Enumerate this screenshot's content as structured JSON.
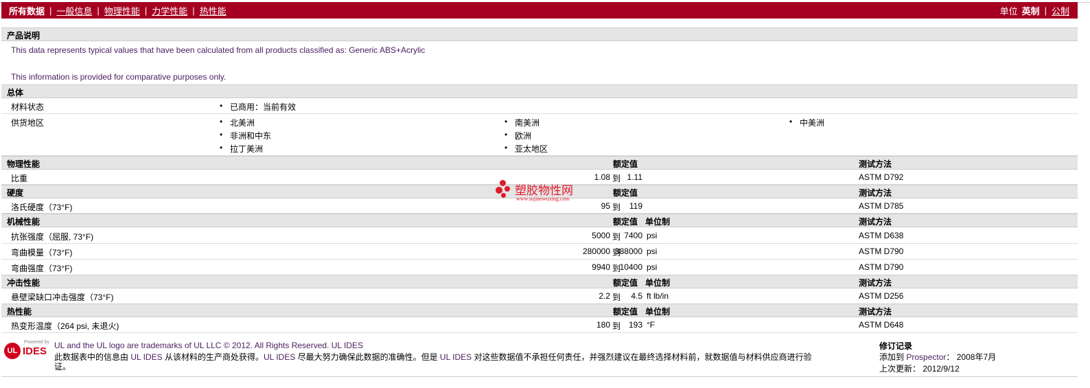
{
  "nav": {
    "all_data": "所有数据",
    "general": "一般信息",
    "physical": "物理性能",
    "mechanical": "力学性能",
    "thermal": "热性能",
    "unit_label": "单位",
    "imperial": "英制",
    "metric": "公制"
  },
  "product": {
    "header": "产品说明",
    "line1": "This data represents typical values that have been calculated from all products classified as: Generic ABS+Acrylic",
    "line2": "This information is provided for comparative purposes only."
  },
  "general": {
    "header": "总体",
    "status_label": "材料状态",
    "status_value": "已商用：当前有效",
    "region_label": "供货地区",
    "regions": [
      "北美洲",
      "非洲和中东",
      "拉丁美洲",
      "南美洲",
      "欧洲",
      "亚太地区",
      "中美洲"
    ]
  },
  "physical": {
    "header": "物理性能",
    "nominal": "额定值",
    "method": "测试方法",
    "rows": [
      {
        "name": "比重",
        "low": "1.08",
        "to": "到",
        "high": "1.11",
        "unit": "",
        "method": "ASTM D792"
      }
    ]
  },
  "hardness": {
    "header": "硬度",
    "nominal": "额定值",
    "method": "测试方法",
    "rows": [
      {
        "name": "洛氏硬度（73°F)",
        "low": "95",
        "to": "到",
        "high": "119",
        "unit": "",
        "method": "ASTM D785"
      }
    ]
  },
  "mechanical": {
    "header": "机械性能",
    "nominal": "额定值",
    "unit": "单位制",
    "method": "测试方法",
    "rows": [
      {
        "name": "抗张强度（屈服, 73°F)",
        "low": "5000",
        "to": "到",
        "high": "7400",
        "unit": "psi",
        "method": "ASTM D638"
      },
      {
        "name": "弯曲模量（73°F)",
        "low": "280000",
        "to": "到",
        "high": "388000",
        "unit": "psi",
        "method": "ASTM D790"
      },
      {
        "name": "弯曲强度（73°F)",
        "low": "9940",
        "to": "到",
        "high": "10400",
        "unit": "psi",
        "method": "ASTM D790"
      }
    ]
  },
  "impact": {
    "header": "冲击性能",
    "nominal": "额定值",
    "unit": "单位制",
    "method": "测试方法",
    "rows": [
      {
        "name": "悬壁梁缺口冲击强度（73°F)",
        "low": "2.2",
        "to": "到",
        "high": "4.5",
        "unit": "ft lb/in",
        "method": "ASTM D256"
      }
    ]
  },
  "thermal": {
    "header": "热性能",
    "nominal": "额定值",
    "unit": "单位制",
    "method": "测试方法",
    "rows": [
      {
        "name": "热变形温度（264 psi, 未退火)",
        "low": "180",
        "to": "到",
        "high": "193",
        "unit": "°F",
        "method": "ASTM D648"
      }
    ]
  },
  "watermark": {
    "title": "塑胶物性网",
    "url": "www.sujiaowuxing.com"
  },
  "footer": {
    "logo_powered": "Powered by",
    "logo_ul": "UL",
    "logo_ides": "IDES",
    "trademark": "UL and the UL logo are trademarks of UL LLC © 2012. All Rights Reserved.",
    "ul_ides_link": "UL IDES",
    "disclaimer_1": "此数据表中的信息由",
    "disclaimer_link1": "UL IDES",
    "disclaimer_2": "从该材料的生产商处获得。",
    "disclaimer_link2": "UL IDES",
    "disclaimer_3": "尽最大努力确保此数据的准确性。但是",
    "disclaimer_link3": "UL IDES",
    "disclaimer_4": "对这些数据值不承担任何责任，并强烈建议在最终选择材料前，就数据值与材料供应商进行验",
    "disclaimer_5": "证。",
    "revision_title": "修订记录",
    "added_label": "添加到",
    "prospector": "Prospector",
    "added_colon": "：",
    "added_date": "2008年7月",
    "updated_label": "上次更新：",
    "updated_date": "2012/9/12"
  }
}
